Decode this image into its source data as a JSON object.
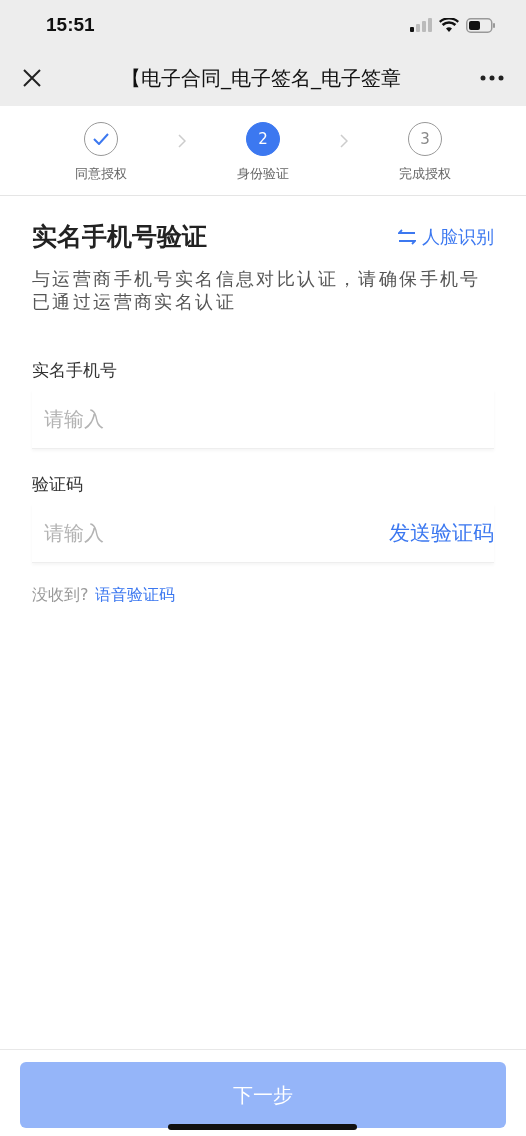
{
  "status_bar": {
    "time": "15:51"
  },
  "nav_bar": {
    "title": "【电子合同_电子签名_电子签章"
  },
  "steps": [
    {
      "label": "同意授权",
      "kind": "done"
    },
    {
      "number": "2",
      "label": "身份验证",
      "kind": "current"
    },
    {
      "number": "3",
      "label": "完成授权",
      "kind": "pending"
    }
  ],
  "heading": "实名手机号验证",
  "switch_link": "人脸识别",
  "description": "与运营商手机号实名信息对比认证，请确保手机号已通过运营商实名认证",
  "fields": [
    {
      "label": "实名手机号",
      "placeholder": "请输入"
    },
    {
      "label": "验证码",
      "placeholder": "请输入",
      "action": "发送验证码"
    }
  ],
  "hint": {
    "text": "没收到?",
    "link": "语音验证码"
  },
  "next_button": {
    "label": "下一步",
    "disabled": true
  }
}
